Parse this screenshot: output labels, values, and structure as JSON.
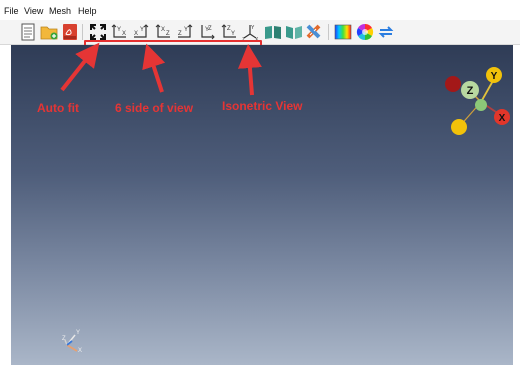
{
  "menu": {
    "file": "File",
    "view": "View",
    "mesh": "Mesh",
    "help": "Help"
  },
  "toolbar": {
    "buttons": [
      {
        "name": "new-file-icon"
      },
      {
        "name": "open-folder-icon"
      },
      {
        "name": "export-pdf-icon"
      },
      {
        "name": "auto-fit-icon"
      },
      {
        "name": "view-xy-icon",
        "axes": [
          "Y",
          "X"
        ]
      },
      {
        "name": "view-yx-icon",
        "axes": [
          "Y",
          "X"
        ]
      },
      {
        "name": "view-xz-icon",
        "axes": [
          "X",
          "Z"
        ]
      },
      {
        "name": "view-zx-icon",
        "axes": [
          "Y",
          "Z"
        ]
      },
      {
        "name": "view-yz-icon",
        "axes": [
          "Y",
          "Z"
        ]
      },
      {
        "name": "view-zy-icon",
        "axes": [
          "Z",
          "Y"
        ]
      },
      {
        "name": "isometric-view-icon",
        "axes": [
          "Z",
          "X",
          "Y"
        ]
      },
      {
        "name": "open-book-icon"
      },
      {
        "name": "open-book-back-icon"
      },
      {
        "name": "clipping-tool-icon"
      },
      {
        "name": "color-bar-icon"
      },
      {
        "name": "color-wheel-icon"
      },
      {
        "name": "refresh-icon"
      }
    ],
    "highlight_color": "#e53030"
  },
  "annotations": {
    "auto_fit": "Auto fit",
    "six_views": "6 side of view",
    "isometric": "Isonetric View",
    "color": "#e53535"
  },
  "viewport": {
    "gradient_top": "#2f3c56",
    "gradient_bottom": "#aab6c8",
    "orientation_widget": {
      "labels": {
        "z": "Z",
        "y": "Y",
        "x": "X"
      },
      "colors": {
        "z": "#b8d8a0",
        "y": "#f2c20a",
        "x": "#e2362a",
        "dark_red": "#a31818",
        "yellow": "#f2c20a"
      }
    },
    "corner_axes": {
      "y": "Y",
      "z": "Z",
      "x": "X"
    }
  }
}
